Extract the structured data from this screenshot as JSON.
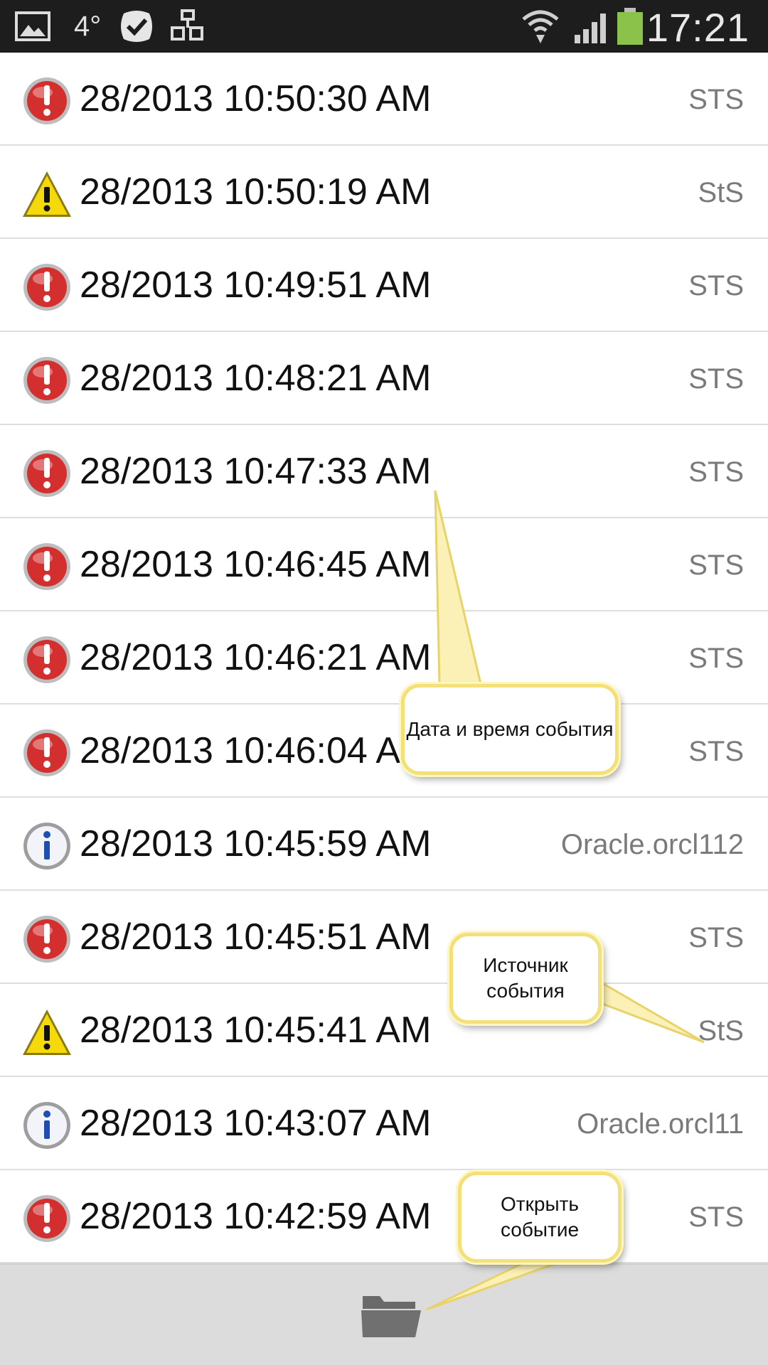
{
  "status_bar": {
    "temperature": "4°",
    "clock": "17:21",
    "battery_color": "#8bc34a"
  },
  "events": [
    {
      "level": "error",
      "datetime": "28/2013 10:50:30 AM",
      "source": "STS"
    },
    {
      "level": "warning",
      "datetime": "28/2013 10:50:19 AM",
      "source": "StS"
    },
    {
      "level": "error",
      "datetime": "28/2013 10:49:51 AM",
      "source": "STS"
    },
    {
      "level": "error",
      "datetime": "28/2013 10:48:21 AM",
      "source": "STS"
    },
    {
      "level": "error",
      "datetime": "28/2013 10:47:33 AM",
      "source": "STS"
    },
    {
      "level": "error",
      "datetime": "28/2013 10:46:45 AM",
      "source": "STS"
    },
    {
      "level": "error",
      "datetime": "28/2013 10:46:21 AM",
      "source": "STS"
    },
    {
      "level": "error",
      "datetime": "28/2013 10:46:04 AM",
      "source": "STS"
    },
    {
      "level": "info",
      "datetime": "28/2013 10:45:59 AM",
      "source": "Oracle.orcl112"
    },
    {
      "level": "error",
      "datetime": "28/2013 10:45:51 AM",
      "source": "STS"
    },
    {
      "level": "warning",
      "datetime": "28/2013 10:45:41 AM",
      "source": "StS"
    },
    {
      "level": "info",
      "datetime": "28/2013 10:43:07 AM",
      "source": "Oracle.orcl11"
    },
    {
      "level": "error",
      "datetime": "28/2013 10:42:59 AM",
      "source": "STS"
    }
  ],
  "level_icons": {
    "error": "error-icon",
    "warning": "warning-icon",
    "info": "info-icon"
  },
  "colors": {
    "error": "#d32f2f",
    "warning": "#f5d90a",
    "info": "#1e4fb0",
    "callout_border": "#f4e07a"
  },
  "callouts": {
    "datetime": "Дата и время события",
    "source": "Источник события",
    "open": "Открыть событие"
  },
  "bottom_bar": {
    "open_icon": "folder-icon"
  }
}
